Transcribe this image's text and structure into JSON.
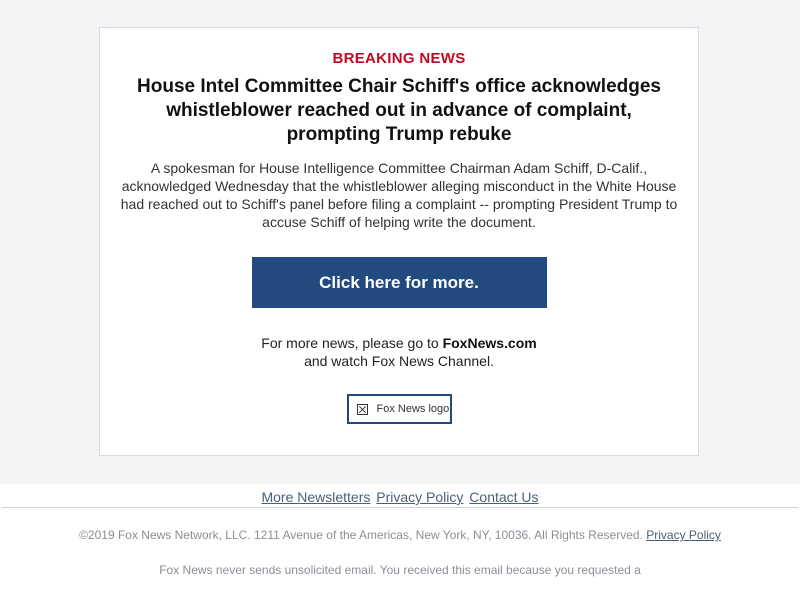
{
  "alert": {
    "eyebrow": "BREAKING NEWS",
    "headline": "House Intel Committee Chair Schiff's office acknowledges whistleblower reached out in advance of complaint, prompting Trump rebuke",
    "summary": "A spokesman for House Intelligence Committee Chairman Adam Schiff, D-Calif., acknowledged Wednesday that the whistleblower alleging misconduct in the White House had reached out to Schiff's panel before filing a complaint -- prompting President Trump to accuse Schiff of helping write the document.",
    "cta_label": "Click here for more."
  },
  "more_news": {
    "prefix": "For more news, please go to ",
    "site": "FoxNews.com",
    "line2": "and watch Fox News Channel."
  },
  "logo": {
    "alt_text": "Fox News logo"
  },
  "footer": {
    "links": {
      "more_newsletters": "More Newsletters",
      "privacy_policy": "Privacy Policy",
      "contact_us": "Contact Us"
    },
    "copyright_text": "©2019 Fox News Network, LLC. 1211 Avenue of the Americas, New York, NY, 10036. All Rights Reserved.",
    "copyright_link": "Privacy Policy",
    "disclaimer": "Fox News never sends unsolicited email. You received this email because you requested a"
  },
  "colors": {
    "eyebrow": "#c20a23",
    "cta_background": "#224a7f",
    "link": "#4a5f79"
  }
}
